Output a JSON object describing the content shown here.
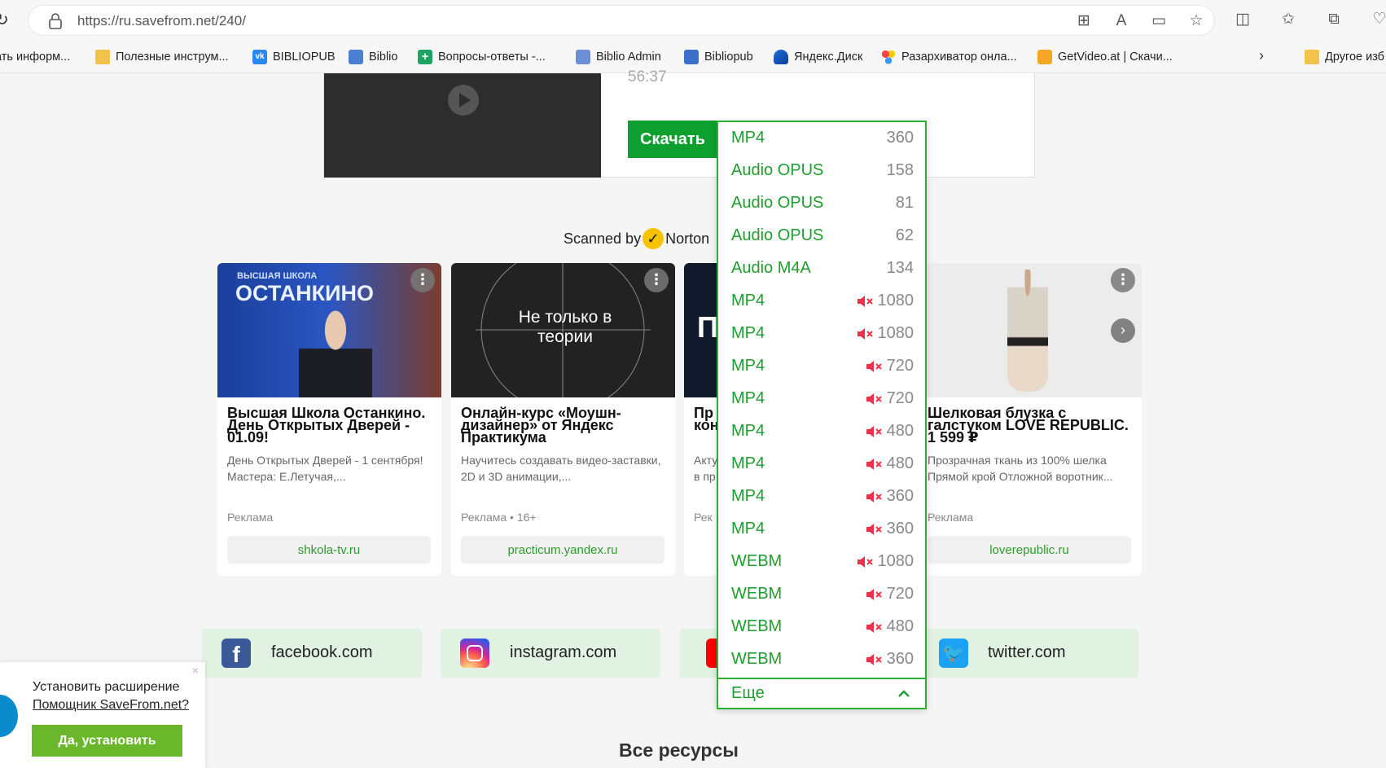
{
  "browser": {
    "url": "https://ru.savefrom.net/240/",
    "bookmarks": [
      {
        "label": "ать информ...",
        "icon": "partial-icon"
      },
      {
        "label": "Полезные инструм...",
        "icon": "folder-icon"
      },
      {
        "label": "BIBLIOPUB",
        "icon": "vk-icon"
      },
      {
        "label": "Biblio",
        "icon": "biblio-icon"
      },
      {
        "label": "Вопросы-ответы -...",
        "icon": "plus-icon"
      },
      {
        "label": "Biblio Admin",
        "icon": "biblio-admin-icon"
      },
      {
        "label": "Bibliopub",
        "icon": "bibliopub-icon"
      },
      {
        "label": "Яндекс.Диск",
        "icon": "yandex-disk-icon"
      },
      {
        "label": "Разархиватор онла...",
        "icon": "archiver-icon"
      },
      {
        "label": "GetVideo.at | Скачи...",
        "icon": "getvideo-icon"
      }
    ],
    "other_bookmarks": "Другое изб"
  },
  "video": {
    "duration": "56:37",
    "download_label": "Скачать"
  },
  "scanned_by": "Scanned by",
  "norton": "Norton",
  "ads": [
    {
      "image_text_top": "ВЫСШАЯ ШКОЛА",
      "image_text_main": "ОСТАНКИНО",
      "title": "Высшая Школа Останкино. День Открытых Дверей - 01.09!",
      "desc": "День Открытых Дверей - 1 сентября! Мастера: Е.Летучая,...",
      "label": "Реклама",
      "domain": "shkola-tv.ru"
    },
    {
      "image_text": "Не только в теории",
      "title": "Онлайн-курс «Моушн-дизайнер» от Яндекс Практикума",
      "desc": "Научитесь создавать видео-заставки, 2D и 3D анимации,...",
      "label": "Реклама • 16+",
      "domain": "practicum.yandex.ru"
    },
    {
      "title": "Пр кон",
      "desc": "Акту в пр",
      "label": "Рек"
    },
    {
      "title": "Шелковая блузка с галстуком LOVE REPUBLIC. 1 599 ₽",
      "desc": "Прозрачная ткань из 100% шелка Прямой крой Отложной воротник...",
      "label": "Реклама",
      "domain": "loverepublic.ru"
    }
  ],
  "social": [
    {
      "label": "facebook.com",
      "color": "#3b5998"
    },
    {
      "label": "instagram.com",
      "color": "#d6249f"
    },
    {
      "label": "",
      "color": "#ff0000"
    },
    {
      "label": "twitter.com",
      "color": "#1da1f2"
    }
  ],
  "all_resources": "Все ресурсы",
  "install": {
    "line1": "Установить расширение",
    "line2": "Помощник SaveFrom.net?",
    "button": "Да, установить",
    "close": "×"
  },
  "dropdown": {
    "items": [
      {
        "format": "MP4",
        "quality": "360",
        "muted": false
      },
      {
        "format": "Audio OPUS",
        "quality": "158",
        "muted": false
      },
      {
        "format": "Audio OPUS",
        "quality": "81",
        "muted": false
      },
      {
        "format": "Audio OPUS",
        "quality": "62",
        "muted": false
      },
      {
        "format": "Audio M4A",
        "quality": "134",
        "muted": false
      },
      {
        "format": "MP4",
        "quality": "1080",
        "muted": true
      },
      {
        "format": "MP4",
        "quality": "1080",
        "muted": true
      },
      {
        "format": "MP4",
        "quality": "720",
        "muted": true
      },
      {
        "format": "MP4",
        "quality": "720",
        "muted": true
      },
      {
        "format": "MP4",
        "quality": "480",
        "muted": true
      },
      {
        "format": "MP4",
        "quality": "480",
        "muted": true
      },
      {
        "format": "MP4",
        "quality": "360",
        "muted": true
      },
      {
        "format": "MP4",
        "quality": "360",
        "muted": true
      },
      {
        "format": "WEBM",
        "quality": "1080",
        "muted": true
      },
      {
        "format": "WEBM",
        "quality": "720",
        "muted": true
      },
      {
        "format": "WEBM",
        "quality": "480",
        "muted": true
      },
      {
        "format": "WEBM",
        "quality": "360",
        "muted": true
      }
    ],
    "more_label": "Еще"
  },
  "colors": {
    "accent_green": "#1e9e2e",
    "download_green": "#0ea02e",
    "mute_red": "#e8334a"
  }
}
